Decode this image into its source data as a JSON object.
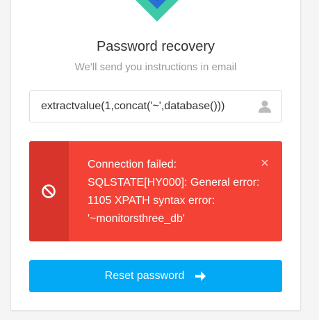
{
  "header": {
    "title": "Password recovery",
    "subtitle": "We'll send you instructions in email"
  },
  "form": {
    "email_value": "extractvalue(1,concat('~',database()))"
  },
  "alert": {
    "message": "Connection failed: SQLSTATE[HY000]: General error: 1105 XPATH syntax error: '~monitorsthree_db'",
    "color": "#f44336"
  },
  "actions": {
    "reset_label": "Reset password",
    "color": "#03a9f4"
  },
  "icons": {
    "logo": "cube-logo",
    "input": "user-icon",
    "alert": "ban-icon",
    "close": "close-icon",
    "button": "arrow-right-icon"
  }
}
